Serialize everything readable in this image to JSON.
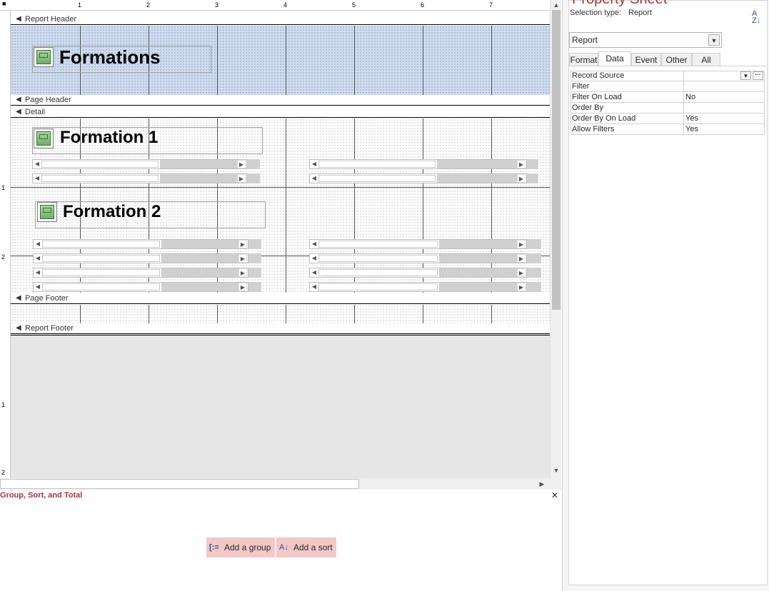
{
  "ruler": {
    "h_numbers": [
      "1",
      "2",
      "3",
      "4",
      "5",
      "6",
      "7"
    ],
    "v_numbers": [
      "1",
      "2",
      "1",
      "2"
    ]
  },
  "sections": {
    "report_header": "Report Header",
    "page_header": "Page Header",
    "detail": "Detail",
    "page_footer": "Page Footer",
    "report_footer": "Report Footer"
  },
  "report": {
    "title": "Formations",
    "formation1": "Formation 1",
    "formation2": "Formation 2"
  },
  "group_sort_total": {
    "title": "Group, Sort, and Total",
    "add_group": "Add a group",
    "add_sort": "Add a sort",
    "close_glyph": "✕"
  },
  "property_sheet": {
    "title": "Property Sheet",
    "selection_type_label": "Selection type:",
    "selection_type_value": "Report",
    "object_selected": "Report",
    "tabs": [
      "Format",
      "Data",
      "Event",
      "Other",
      "All"
    ],
    "selected_tab": "Data",
    "rows": [
      {
        "name": "Record Source",
        "value": ""
      },
      {
        "name": "Filter",
        "value": ""
      },
      {
        "name": "Filter On Load",
        "value": "No"
      },
      {
        "name": "Order By",
        "value": ""
      },
      {
        "name": "Order By On Load",
        "value": "Yes"
      },
      {
        "name": "Allow Filters",
        "value": "Yes"
      }
    ]
  },
  "colors": {
    "accent": "#a4373a",
    "header_fill": "#cfdcf0",
    "button_fill": "#f4c7c9"
  }
}
